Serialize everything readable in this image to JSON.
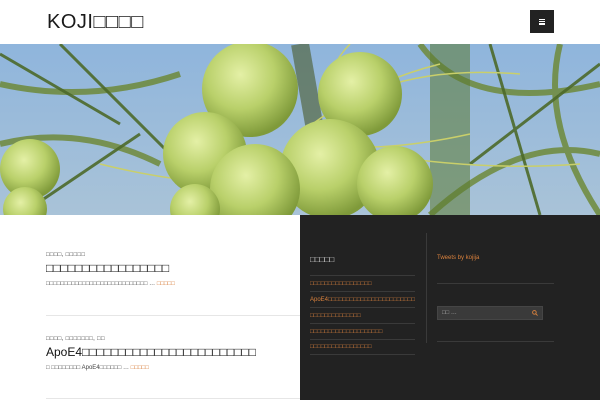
{
  "site": {
    "title": "KOJI□□□□"
  },
  "header": {
    "menu_icon": "hamburger-icon"
  },
  "hero": {
    "alt": "coconut-palm-image"
  },
  "posts": [
    {
      "categories": "□□□□, □□□□□",
      "title": "□□□□□□□□□□□□□□□□□",
      "excerpt": "□□□□□□□□□□□□□□□□□□□□□□□□□□□□ …",
      "more": "□□□□□"
    },
    {
      "categories": "□□□□, □□□□□□□, □□",
      "title": "ApoE4□□□□□□□□□□□□□□□□□□□□□□□□",
      "excerpt": "□ □□□□□□□□ ApoE4□□□□□□ …",
      "more": "□□□□□"
    }
  ],
  "sidebar": {
    "recent_title": "□□□□□",
    "recent_items": [
      "□□□□□□□□□□□□□□□□□",
      "ApoE4□□□□□□□□□□□□□□□□□□□□□□□□",
      "□□□□□□□□□□□□□□",
      "□□□□□□□□□□□□□□□□□□□□",
      "□□□□□□□□□□□□□□□□□"
    ],
    "tweets_label": "Tweets by kojija",
    "search_placeholder": "□□ …",
    "search_icon": "search-icon"
  },
  "colors": {
    "accent": "#d9813d",
    "sidebar_bg": "#222222",
    "menu_bg": "#222222"
  }
}
